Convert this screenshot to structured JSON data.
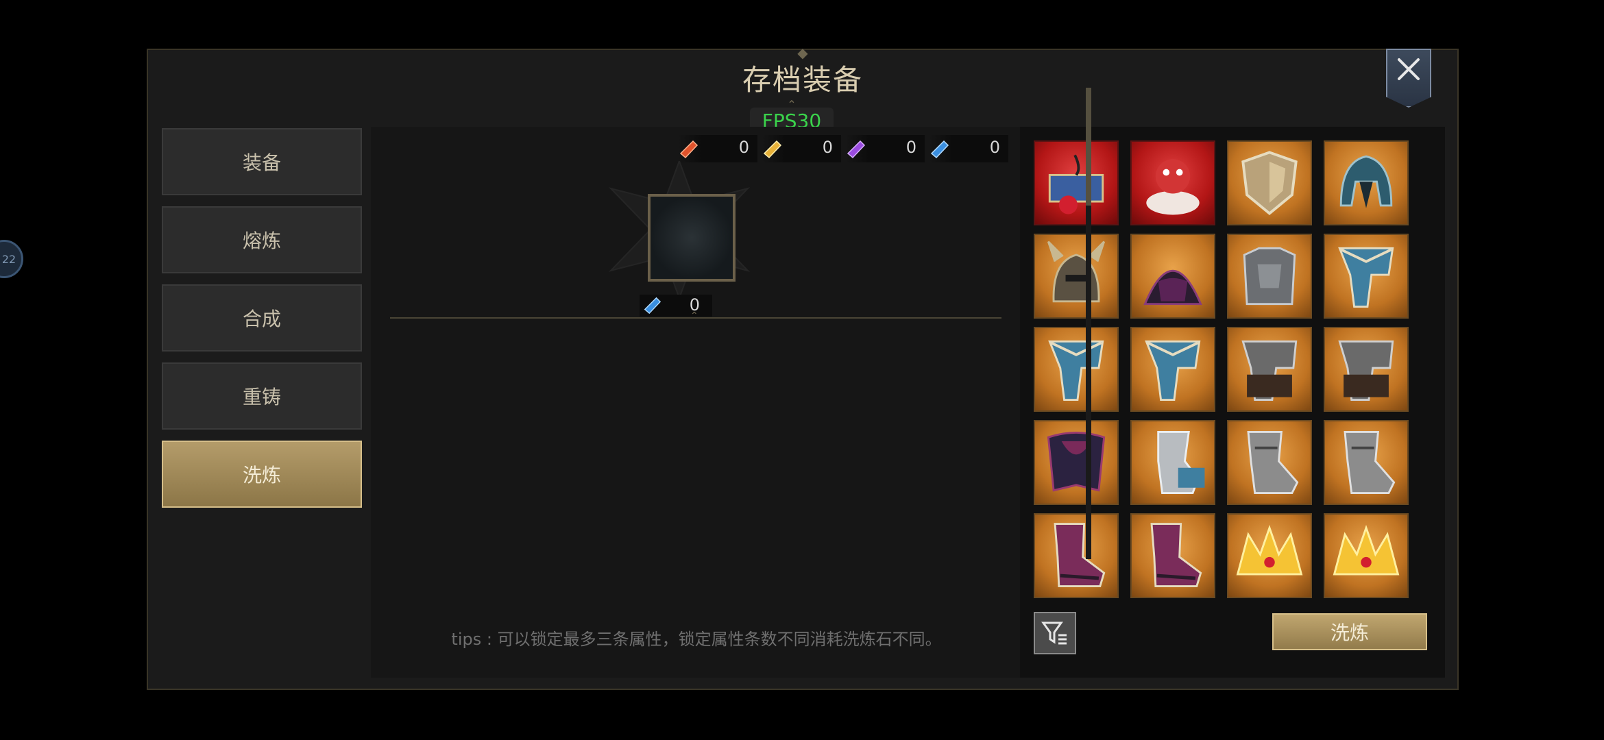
{
  "window": {
    "title": "存档装备",
    "fps": "FPS30",
    "side_bubble": "22"
  },
  "menu": {
    "items": [
      {
        "label": "装备"
      },
      {
        "label": "熔炼"
      },
      {
        "label": "合成"
      },
      {
        "label": "重铸"
      },
      {
        "label": "洗炼",
        "active": true
      }
    ]
  },
  "currencies": [
    {
      "icon": "red-gem-icon",
      "value": "0",
      "color": "#e0532c"
    },
    {
      "icon": "gold-gem-icon",
      "value": "0",
      "color": "#e8b23a"
    },
    {
      "icon": "purple-gem-icon",
      "value": "0",
      "color": "#9a4be0"
    },
    {
      "icon": "blue-gem-icon",
      "value": "0",
      "color": "#3b8fe0"
    }
  ],
  "slot": {
    "cost_icon": "blue-gem-icon",
    "cost": "0"
  },
  "tips": "tips : 可以锁定最多三条属性，锁定属性条数不同消耗洗炼石不同。",
  "inventory": {
    "items": [
      {
        "name": "treasure-chest-item",
        "rarity": "red"
      },
      {
        "name": "monster-figurine-item",
        "rarity": "red"
      },
      {
        "name": "shield-item",
        "rarity": "orange"
      },
      {
        "name": "spiked-helmet-item",
        "rarity": "orange"
      },
      {
        "name": "horned-helmet-item",
        "rarity": "orange"
      },
      {
        "name": "wizard-hat-item",
        "rarity": "orange"
      },
      {
        "name": "plate-armor-item",
        "rarity": "orange"
      },
      {
        "name": "blue-pants-item",
        "rarity": "orange"
      },
      {
        "name": "blue-pants-item",
        "rarity": "orange"
      },
      {
        "name": "blue-pants-item",
        "rarity": "orange"
      },
      {
        "name": "dark-pants-item",
        "rarity": "orange"
      },
      {
        "name": "dark-pants-item",
        "rarity": "orange"
      },
      {
        "name": "cloak-pants-item",
        "rarity": "orange"
      },
      {
        "name": "silver-greaves-item",
        "rarity": "orange"
      },
      {
        "name": "steel-boots-item",
        "rarity": "orange"
      },
      {
        "name": "steel-boots-item",
        "rarity": "orange"
      },
      {
        "name": "purple-boots-item",
        "rarity": "orange"
      },
      {
        "name": "purple-boots-item",
        "rarity": "orange"
      },
      {
        "name": "gold-crown-item",
        "rarity": "orange"
      },
      {
        "name": "gold-crown-item",
        "rarity": "orange"
      }
    ],
    "action_label": "洗炼",
    "filter_icon": "filter-icon"
  }
}
